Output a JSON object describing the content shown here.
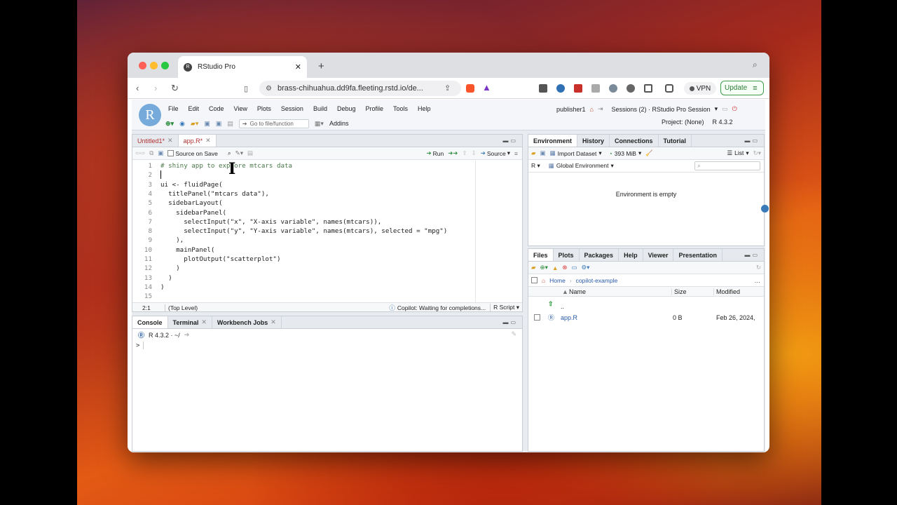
{
  "browser": {
    "tab_title": "RStudio Pro",
    "url": "brass-chihuahua.dd9fa.fleeting.rstd.io/de...",
    "vpn_label": "VPN",
    "update_label": "Update"
  },
  "rstudio": {
    "menu": [
      "File",
      "Edit",
      "Code",
      "View",
      "Plots",
      "Session",
      "Build",
      "Debug",
      "Profile",
      "Tools",
      "Help"
    ],
    "toolbar": {
      "goto_placeholder": "Go to file/function",
      "addins": "Addins"
    },
    "user": "publisher1",
    "sessions": "Sessions (2) · RStudio Pro Session",
    "project": "Project: (None)",
    "r_version": "R 4.3.2"
  },
  "editor": {
    "tabs": [
      {
        "label": "Untitled1*"
      },
      {
        "label": "app.R*"
      }
    ],
    "source_on_save": "Source on Save",
    "run_label": "Run",
    "source_label": "Source",
    "lines": [
      {
        "num": "1",
        "text": "# shiny app to explore mtcars data"
      },
      {
        "num": "2",
        "text": ""
      },
      {
        "num": "3",
        "text": "ui <- fluidPage("
      },
      {
        "num": "4",
        "text": "  titlePanel(\"mtcars data\"),"
      },
      {
        "num": "5",
        "text": "  sidebarLayout("
      },
      {
        "num": "6",
        "text": "    sidebarPanel("
      },
      {
        "num": "7",
        "text": "      selectInput(\"x\", \"X-axis variable\", names(mtcars)),"
      },
      {
        "num": "8",
        "text": "      selectInput(\"y\", \"Y-axis variable\", names(mtcars), selected = \"mpg\")"
      },
      {
        "num": "9",
        "text": "    ),"
      },
      {
        "num": "10",
        "text": "    mainPanel("
      },
      {
        "num": "11",
        "text": "      plotOutput(\"scatterplot\")"
      },
      {
        "num": "12",
        "text": "    )"
      },
      {
        "num": "13",
        "text": "  )"
      },
      {
        "num": "14",
        "text": ")"
      },
      {
        "num": "15",
        "text": ""
      }
    ],
    "status": {
      "position": "2:1",
      "scope": "(Top Level)",
      "copilot": "Copilot: Waiting for completions...",
      "filetype": "R Script"
    }
  },
  "console": {
    "tabs": [
      {
        "label": "Console"
      },
      {
        "label": "Terminal"
      },
      {
        "label": "Workbench Jobs"
      }
    ],
    "version_path": "R 4.3.2 · ~/",
    "prompt": ">"
  },
  "environment": {
    "tabs": [
      {
        "label": "Environment"
      },
      {
        "label": "History"
      },
      {
        "label": "Connections"
      },
      {
        "label": "Tutorial"
      }
    ],
    "import_dataset": "Import Dataset",
    "memory": "393 MiB",
    "list_label": "List",
    "lang": "R",
    "scope": "Global Environment",
    "empty_message": "Environment is empty"
  },
  "files": {
    "tabs": [
      {
        "label": "Files"
      },
      {
        "label": "Plots"
      },
      {
        "label": "Packages"
      },
      {
        "label": "Help"
      },
      {
        "label": "Viewer"
      },
      {
        "label": "Presentation"
      }
    ],
    "breadcrumb": [
      "Home",
      "copilot-example"
    ],
    "columns": {
      "name": "Name",
      "size": "Size",
      "modified": "Modified"
    },
    "up_label": "..",
    "rows": [
      {
        "name": "app.R",
        "size": "0 B",
        "modified": "Feb 26, 2024,"
      }
    ]
  }
}
